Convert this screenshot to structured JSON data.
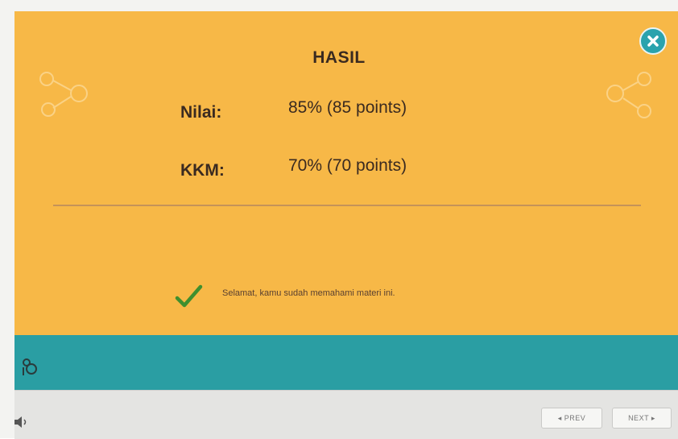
{
  "result": {
    "title": "HASIL",
    "score_label": "Nilai:",
    "score_value": "85% (85 points)",
    "kkm_label": "KKM:",
    "kkm_value": "70% (70 points)",
    "message": "Selamat, kamu sudah memahami materi ini."
  },
  "controls": {
    "prev_label": "◂ PREV",
    "next_label": "NEXT ▸"
  },
  "colors": {
    "slide_background": "#f7b847",
    "bar_background": "#2a9ea3",
    "close_button": "#2aa3ad",
    "check": "#3f8f2e"
  },
  "icons": {
    "close": "close-icon",
    "check": "check-icon",
    "menu": "menu-icon",
    "volume": "volume-icon"
  }
}
